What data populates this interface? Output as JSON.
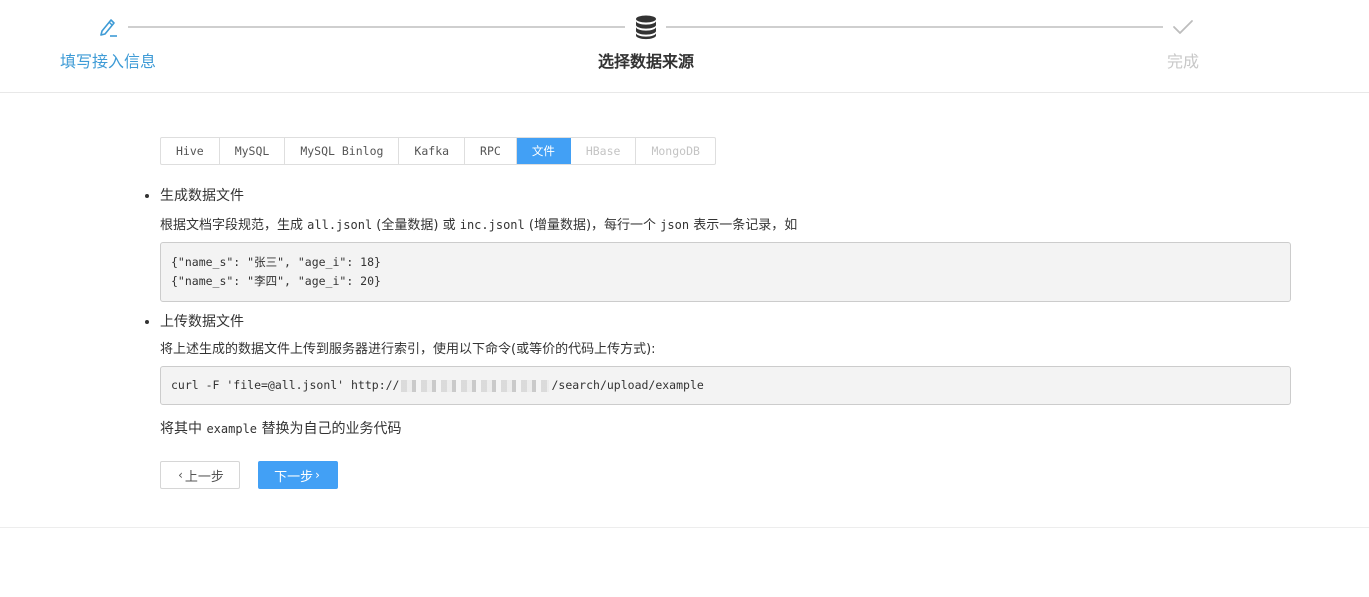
{
  "steps": [
    {
      "label": "填写接入信息",
      "icon": "edit-pencil-icon",
      "state": "done"
    },
    {
      "label": "选择数据来源",
      "icon": "database-icon",
      "state": "current"
    },
    {
      "label": "完成",
      "icon": "check-icon",
      "state": "pending"
    }
  ],
  "tabs": [
    {
      "label": "Hive",
      "state": "normal"
    },
    {
      "label": "MySQL",
      "state": "normal"
    },
    {
      "label": "MySQL Binlog",
      "state": "normal"
    },
    {
      "label": "Kafka",
      "state": "normal"
    },
    {
      "label": "RPC",
      "state": "normal"
    },
    {
      "label": "文件",
      "state": "active"
    },
    {
      "label": "HBase",
      "state": "disabled"
    },
    {
      "label": "MongoDB",
      "state": "disabled"
    }
  ],
  "section1": {
    "title": "生成数据文件",
    "desc_prefix": "根据文档字段规范，生成 ",
    "file_all": "all.jsonl",
    "desc_mid1": " (全量数据) 或 ",
    "file_inc": "inc.jsonl",
    "desc_mid2": " (增量数据)，每行一个 ",
    "json_word": "json",
    "desc_suffix": " 表示一条记录，如",
    "code_lines": [
      "{\"name_s\": \"张三\", \"age_i\": 18}",
      "{\"name_s\": \"李四\", \"age_i\": 20}"
    ]
  },
  "section2": {
    "title": "上传数据文件",
    "desc": "将上述生成的数据文件上传到服务器进行索引，使用以下命令(或等价的代码上传方式):",
    "cmd_prefix": "curl -F 'file=@all.jsonl' http://",
    "cmd_suffix": "/search/upload/example"
  },
  "note": {
    "prefix": "将其中 ",
    "code": "example",
    "suffix": " 替换为自己的业务代码"
  },
  "buttons": {
    "prev_label": "上一步",
    "next_label": "下一步"
  },
  "colors": {
    "accent": "#42a0f5",
    "step_done": "#3e9bd6",
    "disabled": "#c4c4c4"
  }
}
